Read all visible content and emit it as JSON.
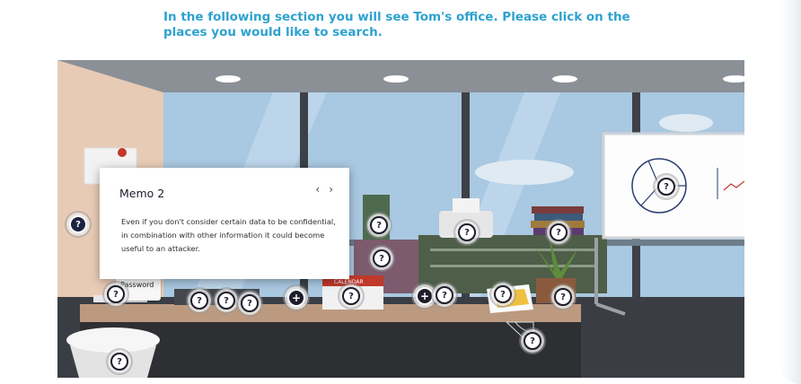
{
  "instruction": "In the following section you will see Tom's office. Please click on the places you would like to search.",
  "memo": {
    "title": "Memo 2",
    "prev": "‹",
    "next": "›",
    "body": "Even if you don't consider certain data to be confidential, in combination with other information it could become useful to an attacker."
  },
  "sticky_note": "Password",
  "calendar_label": "CALENDAR",
  "hotspot_symbols": {
    "question": "?",
    "plus": "+"
  },
  "colors": {
    "instruction": "#2ea2cf",
    "hotspot_border": "#1d1d2b",
    "wall": "#e8cbb5",
    "sky": "#a9c8e1",
    "desk": "#bc9a80"
  }
}
